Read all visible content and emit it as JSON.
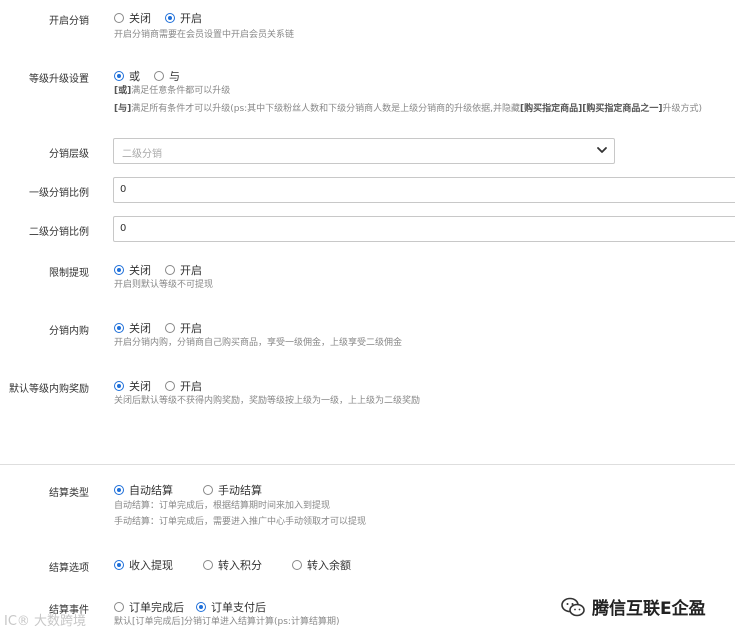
{
  "fx_enable": {
    "label": "开启分销",
    "options": [
      "关闭",
      "开启"
    ],
    "selected": 1,
    "help": "开启分销商需要在会员设置中开启会员关系链"
  },
  "level_upgrade": {
    "label": "等级升级设置",
    "options": [
      "或",
      "与"
    ],
    "selected": 0,
    "help1_tag": "[或]",
    "help1": "满足任意条件都可以升级",
    "help2_tag": "[与]",
    "help2_a": "满足所有条件才可以升级(ps:其中下级粉丝人数和下级分销商人数是上级分销商的升级依据,并隐藏",
    "help2_b": "[购买指定商品]",
    "help2_c": "[购买指定商品之一]",
    "help2_d": "升级方式)"
  },
  "fx_level": {
    "label": "分销层级",
    "value": "二级分销"
  },
  "rate1": {
    "label": "一级分销比例",
    "value": "0"
  },
  "rate2": {
    "label": "二级分销比例",
    "value": "0"
  },
  "withdraw_limit": {
    "label": "限制提现",
    "options": [
      "关闭",
      "开启"
    ],
    "selected": 0,
    "help": "开启则默认等级不可提现"
  },
  "internal_purchase": {
    "label": "分销内购",
    "options": [
      "关闭",
      "开启"
    ],
    "selected": 0,
    "help": "开启分销内购，分销商自己购买商品，享受一级佣金，上级享受二级佣金"
  },
  "default_reward": {
    "label": "默认等级内购奖励",
    "options": [
      "关闭",
      "开启"
    ],
    "selected": 0,
    "help": "关闭后默认等级不获得内购奖励，奖励等级按上级为一级，上上级为二级奖励"
  },
  "settle_type": {
    "label": "结算类型",
    "options": [
      "自动结算",
      "手动结算"
    ],
    "selected": 0,
    "help1": "自动结算：订单完成后，根据结算期时间来加入到提现",
    "help2": "手动结算：订单完成后，需要进入推广中心手动领取才可以提现"
  },
  "settle_option": {
    "label": "结算选项",
    "options": [
      "收入提现",
      "转入积分",
      "转入余额"
    ],
    "selected": 0
  },
  "settle_event": {
    "label": "结算事件",
    "options": [
      "订单完成后",
      "订单支付后"
    ],
    "selected": 1,
    "help": "默认[订单完成后]分销订单进入结算计算(ps:计算结算期)"
  },
  "watermark": {
    "left": "IC® 大数跨境",
    "right": "腾信互联E企盈"
  },
  "colors": {
    "accent": "#1e6fd9",
    "help_text": "#888888",
    "border": "#c8c8c8"
  },
  "icons": {
    "select": "chevron-down-icon",
    "watermark": "wechat-icon"
  }
}
